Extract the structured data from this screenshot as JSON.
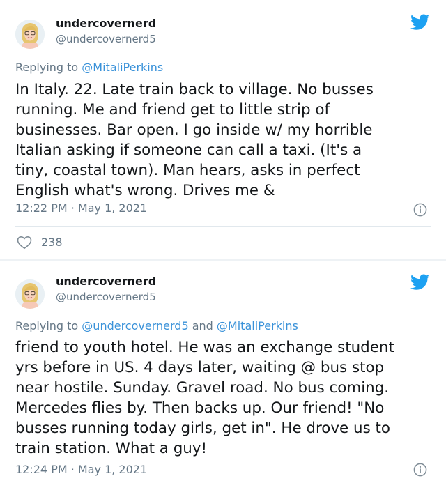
{
  "colors": {
    "link_blue": "#3a92d9",
    "twitter_blue": "#1da1f2",
    "secondary_text": "#657786",
    "primary_text": "#14171a",
    "divider": "#e1e8ed"
  },
  "tweets": [
    {
      "display_name": "undercovernerd",
      "handle": "@undercovernerd5",
      "replying_prefix": "Replying to",
      "replying_to": [
        "@MitaliPerkins"
      ],
      "body_lines": [
        "In Italy. 22. Late train back to village. No busses",
        "running. Me and friend get to little strip of",
        "businesses. Bar open. I go inside w/ my horrible",
        "Italian asking if someone can call a taxi. (It's a",
        "tiny, coastal town). Man hears,  asks in perfect",
        "English what's wrong. Drives me &"
      ],
      "timestamp": "12:22 PM · May 1, 2021",
      "likes": "238",
      "icons": {
        "avatar": "bitmoji-avatar",
        "brand": "twitter-bird-icon",
        "info": "info-icon",
        "like": "heart-icon"
      }
    },
    {
      "display_name": "undercovernerd",
      "handle": "@undercovernerd5",
      "replying_prefix": "Replying to",
      "replying_joiner": "and",
      "replying_to": [
        "@undercovernerd5",
        "@MitaliPerkins"
      ],
      "body_lines": [
        "friend to youth hotel. He was an exchange student",
        "yrs before in US. 4 days later, waiting @ bus stop",
        "near hostile. Sunday. Gravel road. No bus coming.",
        "Mercedes flies by. Then backs up. Our friend!  \"No",
        "busses running today girls, get in\". He drove us to",
        "train station. What a guy!"
      ],
      "timestamp": "12:24 PM · May 1, 2021",
      "icons": {
        "avatar": "bitmoji-avatar",
        "brand": "twitter-bird-icon",
        "info": "info-icon"
      }
    }
  ]
}
